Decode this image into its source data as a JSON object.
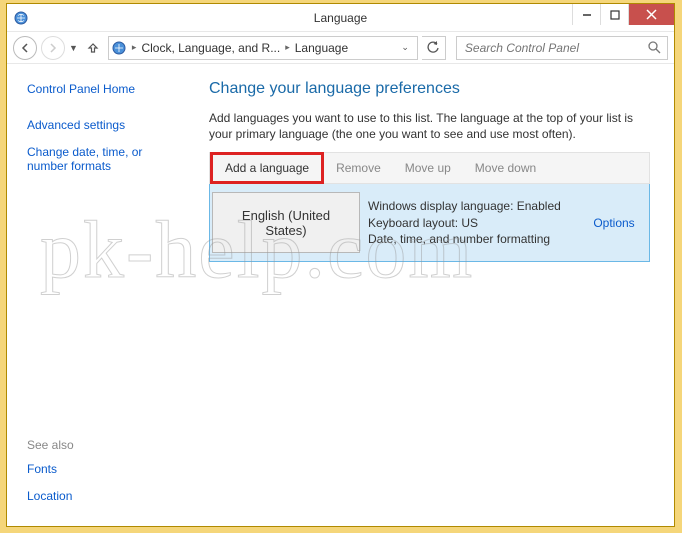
{
  "window": {
    "title": "Language"
  },
  "nav": {
    "breadcrumb": {
      "part1": "Clock, Language, and R...",
      "part2": "Language"
    },
    "search_placeholder": "Search Control Panel"
  },
  "sidebar": {
    "home": "Control Panel Home",
    "links": [
      "Advanced settings",
      "Change date, time, or number formats"
    ],
    "see_also_label": "See also",
    "see_also": [
      "Fonts",
      "Location"
    ]
  },
  "main": {
    "heading": "Change your language preferences",
    "description": "Add languages you want to use to this list. The language at the top of your list is your primary language (the one you want to see and use most often).",
    "toolbar": {
      "add": "Add a language",
      "remove": "Remove",
      "moveup": "Move up",
      "movedown": "Move down"
    },
    "language": {
      "name": "English (United States)",
      "line1": "Windows display language: Enabled",
      "line2": "Keyboard layout: US",
      "line3": "Date, time, and number formatting",
      "options": "Options"
    }
  },
  "watermark": "pk-help.com"
}
